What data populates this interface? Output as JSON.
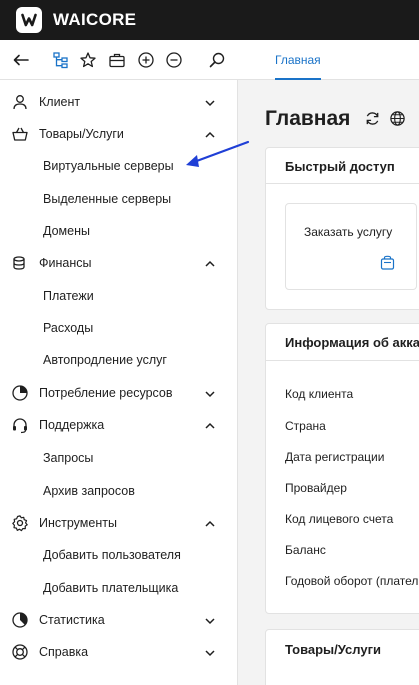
{
  "app": {
    "brand": "WAICORE",
    "logo_letter": "W"
  },
  "toolbar": {
    "icons": [
      "back-arrow-icon",
      "tree-icon",
      "star-icon",
      "briefcase-icon",
      "plus-circle-icon",
      "minus-circle-icon",
      "search-icon"
    ],
    "tab_home": "Главная"
  },
  "sidebar": {
    "client": "Клиент",
    "goods": "Товары/Услуги",
    "virtual_servers": "Виртуальные серверы",
    "dedicated_servers": "Выделенные серверы",
    "domains": "Домены",
    "finance": "Финансы",
    "payments": "Платежи",
    "expenses": "Расходы",
    "autorenew": "Автопродление услуг",
    "resources": "Потребление ресурсов",
    "support": "Поддержка",
    "requests": "Запросы",
    "requests_archive": "Архив запросов",
    "tools": "Инструменты",
    "add_user": "Добавить пользователя",
    "add_payer": "Добавить плательщика",
    "stats": "Статистика",
    "help": "Справка"
  },
  "main": {
    "title": "Главная",
    "quick_access": {
      "title": "Быстрый доступ",
      "order_service": "Заказать услугу"
    },
    "account_info": {
      "title": "Информация об аккаунте",
      "rows": [
        "Код клиента",
        "Страна",
        "Дата регистрации",
        "Провайдер",
        "Код лицевого счета",
        "Баланс",
        "Годовой оборот (плательщика)"
      ]
    },
    "goods_card": {
      "title": "Товары/Услуги"
    }
  },
  "colors": {
    "accent": "#1a73c8",
    "topbar": "#1a1a1a",
    "arrow": "#1f3fd6"
  }
}
